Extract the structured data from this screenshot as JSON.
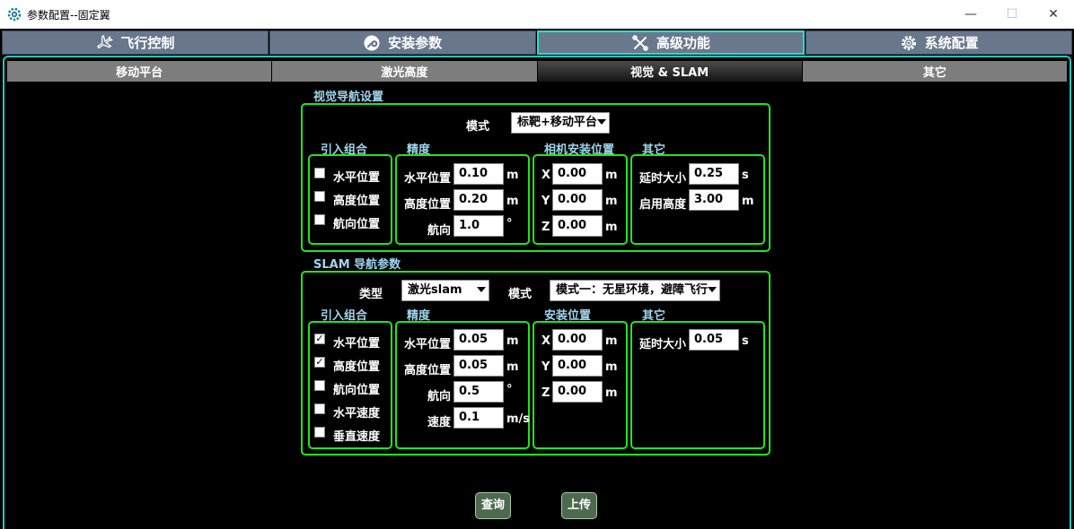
{
  "window": {
    "title": "参数配置--固定翼",
    "minimize": "—",
    "maximize": "☐",
    "close": "✕"
  },
  "main_tabs": [
    {
      "label": "飞行控制",
      "icon": "airplane-icon"
    },
    {
      "label": "安装参数",
      "icon": "wrench-icon"
    },
    {
      "label": "高级功能",
      "icon": "tools-icon",
      "active": true
    },
    {
      "label": "系统配置",
      "icon": "gear-icon"
    }
  ],
  "sub_tabs": [
    {
      "label": "移动平台"
    },
    {
      "label": "激光高度"
    },
    {
      "label": "视觉 & SLAM",
      "active": true
    },
    {
      "label": "其它"
    }
  ],
  "visual": {
    "title": "视觉导航设置",
    "mode_label": "模式",
    "mode_value": "标靶+移动平台",
    "fusion_header": "引入组合",
    "fusion_items": [
      {
        "label": "水平位置",
        "checked": false
      },
      {
        "label": "高度位置",
        "checked": false
      },
      {
        "label": "航向位置",
        "checked": false
      }
    ],
    "precision_header": "精度",
    "precision": [
      {
        "label": "水平位置",
        "value": "0.10",
        "unit": "m"
      },
      {
        "label": "高度位置",
        "value": "0.20",
        "unit": "m"
      },
      {
        "label": "航向",
        "value": "1.0",
        "unit": "°"
      }
    ],
    "camera_header": "相机安装位置",
    "camera": [
      {
        "label": "X",
        "value": "0.00",
        "unit": "m"
      },
      {
        "label": "Y",
        "value": "0.00",
        "unit": "m"
      },
      {
        "label": "Z",
        "value": "0.00",
        "unit": "m"
      }
    ],
    "other_header": "其它",
    "other": [
      {
        "label": "延时大小",
        "value": "0.25",
        "unit": "s"
      },
      {
        "label": "启用高度",
        "value": "3.00",
        "unit": "m"
      }
    ]
  },
  "slam": {
    "title": "SLAM 导航参数",
    "type_label": "类型",
    "type_value": "激光slam",
    "mode_label": "模式",
    "mode_value": "模式一：无星环境，避障飞行",
    "fusion_header": "引入组合",
    "fusion_items": [
      {
        "label": "水平位置",
        "checked": true
      },
      {
        "label": "高度位置",
        "checked": true
      },
      {
        "label": "航向位置",
        "checked": false
      },
      {
        "label": "水平速度",
        "checked": false
      },
      {
        "label": "垂直速度",
        "checked": false
      }
    ],
    "precision_header": "精度",
    "precision": [
      {
        "label": "水平位置",
        "value": "0.05",
        "unit": "m"
      },
      {
        "label": "高度位置",
        "value": "0.05",
        "unit": "m"
      },
      {
        "label": "航向",
        "value": "0.5",
        "unit": "°"
      },
      {
        "label": "速度",
        "value": "0.1",
        "unit": "m/s"
      }
    ],
    "install_header": "安装位置",
    "install": [
      {
        "label": "X",
        "value": "0.00",
        "unit": "m"
      },
      {
        "label": "Y",
        "value": "0.00",
        "unit": "m"
      },
      {
        "label": "Z",
        "value": "0.00",
        "unit": "m"
      }
    ],
    "other_header": "其它",
    "other": [
      {
        "label": "延时大小",
        "value": "0.05",
        "unit": "s"
      }
    ]
  },
  "buttons": {
    "query": "查询",
    "upload": "上传"
  },
  "colors": {
    "accent": "#22e0d4",
    "group_border": "#1ee61e",
    "tab_bg": "#69778d",
    "header_text": "#9fd4ee",
    "button_bg": "#4d6a4f"
  }
}
